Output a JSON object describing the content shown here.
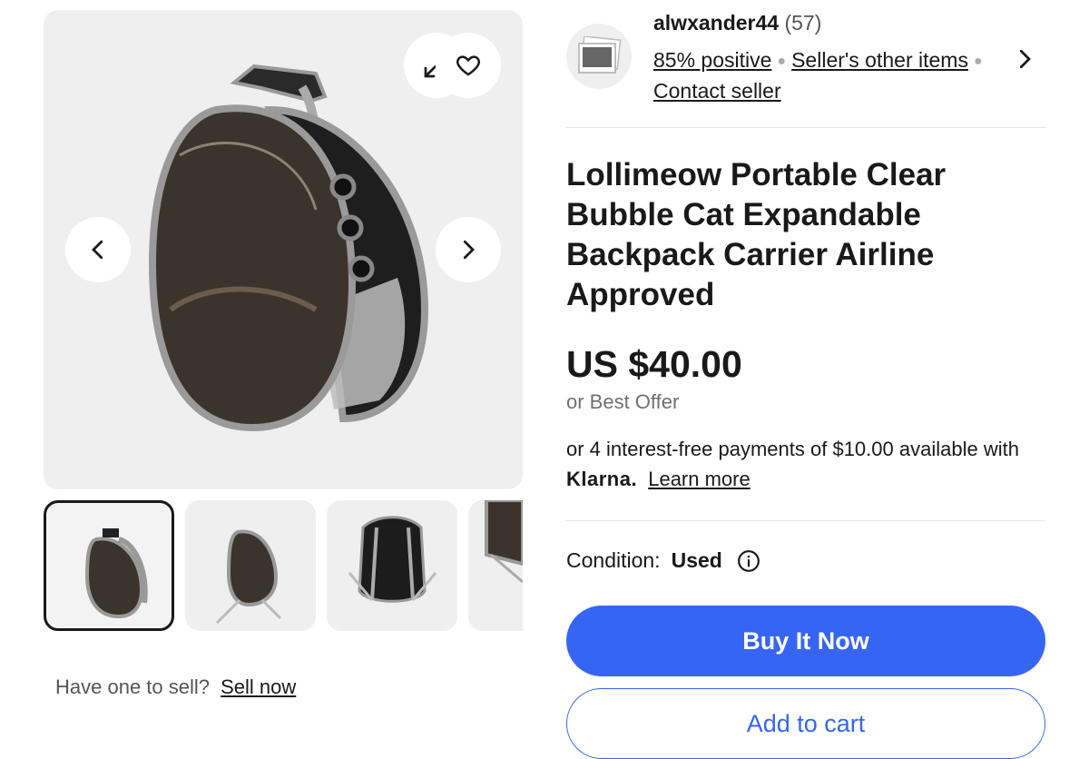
{
  "gallery": {
    "expand_icon": "expand-icon",
    "heart_icon": "heart-icon",
    "prev_icon": "chevron-left-icon",
    "next_icon": "chevron-right-icon",
    "thumbnail_count_visible": 4
  },
  "sell": {
    "prompt": "Have one to sell?",
    "link": "Sell now"
  },
  "seller": {
    "name": "alwxander44",
    "count": "(57)",
    "positive": "85% positive",
    "other_items": "Seller's other items",
    "contact": "Contact seller"
  },
  "listing": {
    "title": "Lollimeow Portable Clear Bubble Cat Expandable Backpack Carrier Airline Approved",
    "price": "US $40.00",
    "best_offer": "or Best Offer",
    "installments": "or 4 interest-free payments of $10.00 available with",
    "klarna": "Klarna.",
    "learn_more": "Learn more",
    "condition_label": "Condition:",
    "condition_value": "Used"
  },
  "actions": {
    "buy_now": "Buy It Now",
    "add_to_cart": "Add to cart"
  },
  "colors": {
    "accent": "#3665f3",
    "text": "#191919",
    "muted": "#707070",
    "panel": "#efefef"
  }
}
